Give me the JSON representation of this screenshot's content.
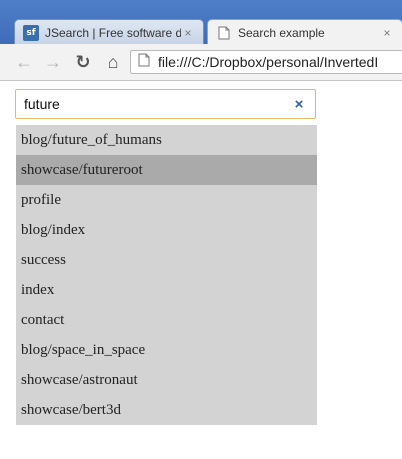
{
  "tabs": [
    {
      "title": "JSearch | Free software dov",
      "favicon": "sf-icon",
      "close": "×"
    },
    {
      "title": "Search example",
      "favicon": "page-icon",
      "close": "×"
    }
  ],
  "toolbar": {
    "back_icon": "←",
    "forward_icon": "→",
    "reload_icon": "↻",
    "home_icon": "⌂",
    "url": "file:///C:/Dropbox/personal/InvertedI"
  },
  "search": {
    "value": "future",
    "clear_icon": "×"
  },
  "results": [
    {
      "label": "blog/future_of_humans"
    },
    {
      "label": "showcase/futureroot",
      "selected": true
    },
    {
      "label": "profile"
    },
    {
      "label": "blog/index"
    },
    {
      "label": "success"
    },
    {
      "label": "index"
    },
    {
      "label": "contact"
    },
    {
      "label": "blog/space_in_space"
    },
    {
      "label": "showcase/astronaut"
    },
    {
      "label": "showcase/bert3d"
    }
  ],
  "colors": {
    "titlebar": "#4a79c4",
    "search_border": "#e5b865",
    "result_bg": "#d3d3d3",
    "result_selected_bg": "#aaaaaa",
    "clear_icon": "#2b5ea8"
  }
}
